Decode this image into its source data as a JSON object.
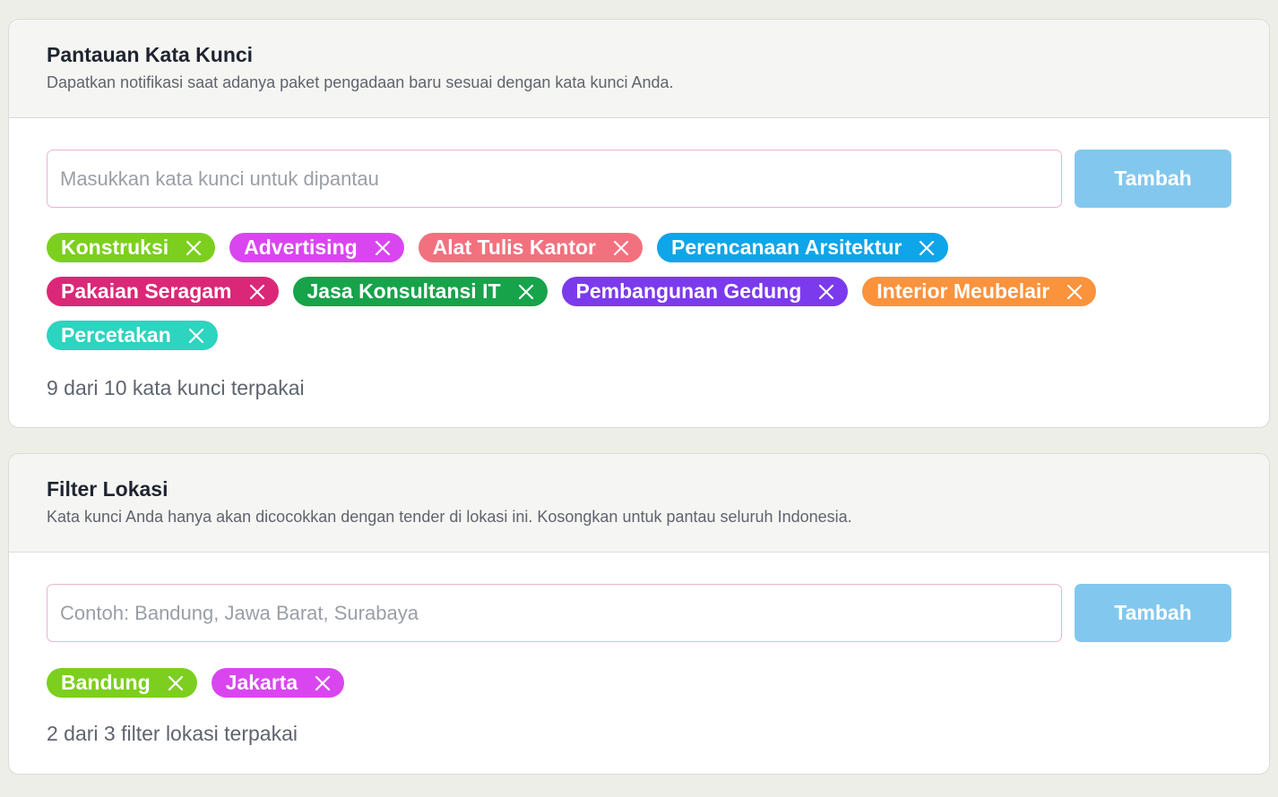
{
  "keywords": {
    "title": "Pantauan Kata Kunci",
    "subtitle": "Dapatkan notifikasi saat adanya paket pengadaan baru sesuai dengan kata kunci Anda.",
    "input_value": "",
    "input_placeholder": "Masukkan kata kunci untuk dipantau",
    "add_label": "Tambah",
    "tags": [
      {
        "label": "Konstruksi",
        "color": "#7ccf1e"
      },
      {
        "label": "Advertising",
        "color": "#d946ef"
      },
      {
        "label": "Alat Tulis Kantor",
        "color": "#f2717f"
      },
      {
        "label": "Perencanaan Arsitektur",
        "color": "#0ea5e9"
      },
      {
        "label": "Pakaian Seragam",
        "color": "#db2777"
      },
      {
        "label": "Jasa Konsultansi IT",
        "color": "#16a34a"
      },
      {
        "label": "Pembangunan Gedung",
        "color": "#7c3aed"
      },
      {
        "label": "Interior Meubelair",
        "color": "#fb923c"
      },
      {
        "label": "Percetakan",
        "color": "#2dd4bf"
      }
    ],
    "usage_text": "9 dari 10 kata kunci terpakai"
  },
  "locations": {
    "title": "Filter Lokasi",
    "subtitle": "Kata kunci Anda hanya akan dicocokkan dengan tender di lokasi ini. Kosongkan untuk pantau seluruh Indonesia.",
    "input_value": "",
    "input_placeholder": "Contoh: Bandung, Jawa Barat, Surabaya",
    "add_label": "Tambah",
    "tags": [
      {
        "label": "Bandung",
        "color": "#7ccf1e"
      },
      {
        "label": "Jakarta",
        "color": "#d946ef"
      }
    ],
    "usage_text": "2 dari 3 filter lokasi terpakai"
  },
  "icons": {
    "tag_remove": "close-icon"
  },
  "colors": {
    "page_background": "#eeeee9",
    "card_background": "#ffffff",
    "header_background": "#f5f5f3",
    "input_border": "#eab4cf",
    "add_button": "#82c8ee"
  }
}
